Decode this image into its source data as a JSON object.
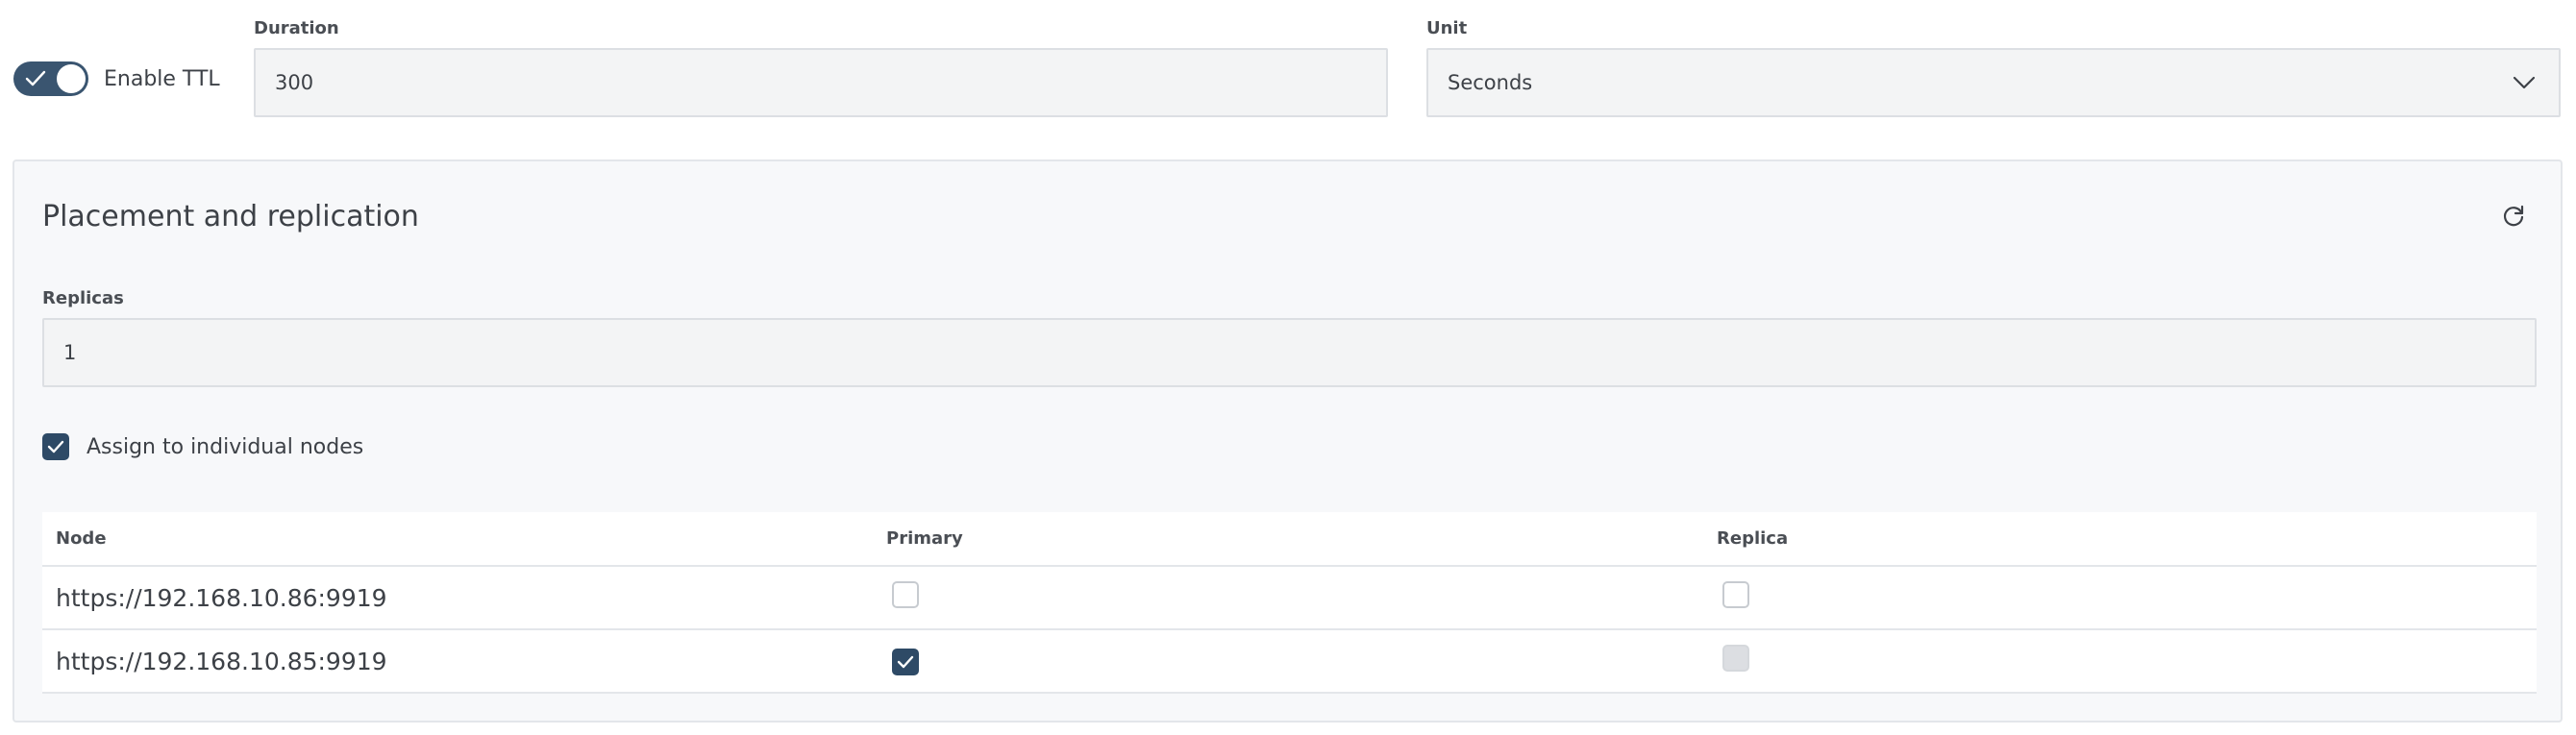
{
  "ttl": {
    "toggle_label": "Enable TTL",
    "enabled": true
  },
  "duration": {
    "label": "Duration",
    "value": "300"
  },
  "unit": {
    "label": "Unit",
    "value": "Seconds"
  },
  "placement": {
    "title": "Placement and replication",
    "replicas_label": "Replicas",
    "replicas_value": "1",
    "assign_label": "Assign to individual nodes",
    "assign_checked": true,
    "columns": [
      "Node",
      "Primary",
      "Replica"
    ],
    "rows": [
      {
        "node": "https://192.168.10.86:9919",
        "primary": "unchecked",
        "replica": "unchecked"
      },
      {
        "node": "https://192.168.10.85:9919",
        "primary": "checked",
        "replica": "disabled"
      }
    ]
  },
  "colors": {
    "accent": "#2e4a66",
    "toggle": "#3a5570",
    "panel_bg": "#f7f8fa",
    "input_bg": "#f3f4f5"
  },
  "icons": {
    "toggle_check": "check-icon",
    "unit_dropdown": "chevron-down-icon",
    "refresh": "refresh-icon"
  }
}
